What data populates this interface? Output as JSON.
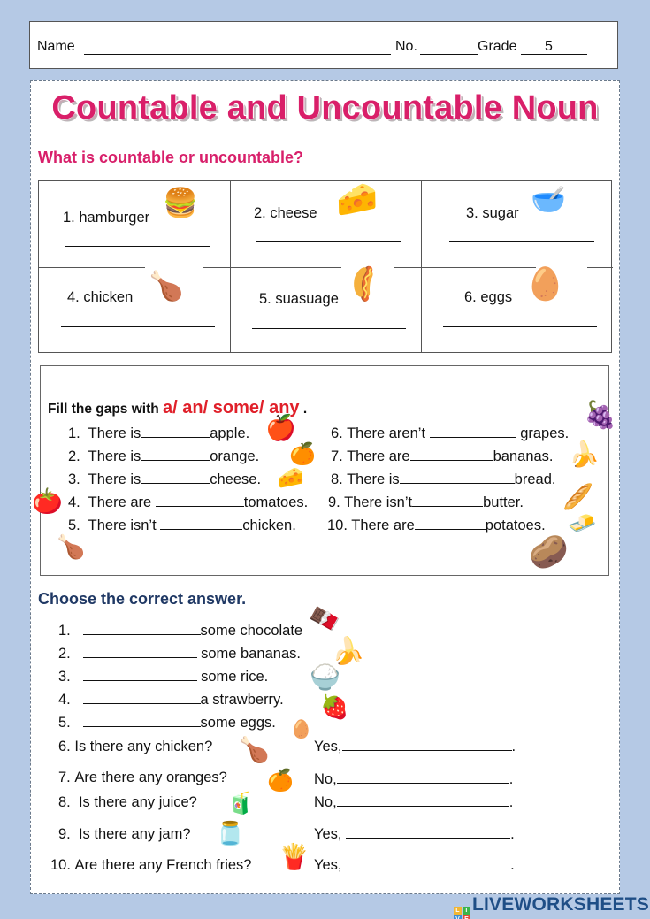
{
  "header": {
    "name_label": "Name",
    "no_label": "No.",
    "grade_label": "Grade",
    "grade_value": "5"
  },
  "title": "Countable and Uncountable Noun",
  "section1": {
    "heading": "What is countable or uncountable?",
    "items": [
      {
        "label": "1. hamburger",
        "icon": "hamburger-icon",
        "glyph": "🍔"
      },
      {
        "label": "2.  cheese",
        "icon": "cheese-icon",
        "glyph": "🧀"
      },
      {
        "label": "3. sugar",
        "icon": "sugar-bowl-icon",
        "glyph": "🥣"
      },
      {
        "label": "4. chicken",
        "icon": "roast-chicken-icon",
        "glyph": "🍗"
      },
      {
        "label": "5. suasuage",
        "icon": "sausage-icon",
        "glyph": "🌭"
      },
      {
        "label": "6. eggs",
        "icon": "eggs-icon",
        "glyph": "🥚"
      }
    ]
  },
  "section2": {
    "heading_prefix": "Fill the gaps with",
    "heading_options": "a/ an/ some/ any",
    "heading_suffix": ".",
    "items": [
      {
        "num": "1.",
        "before": "There is",
        "after": "apple."
      },
      {
        "num": "2.",
        "before": "There is",
        "after": "orange."
      },
      {
        "num": "3.",
        "before": "There is",
        "after": "cheese."
      },
      {
        "num": "4.",
        "before": "There are ",
        "after": "tomatoes."
      },
      {
        "num": "5.",
        "before": "There isn’t ",
        "after": "chicken."
      },
      {
        "num": "6.",
        "before": "There aren’t ",
        "after": " grapes."
      },
      {
        "num": "7.",
        "before": "There are",
        "after": "bananas."
      },
      {
        "num": "8.",
        "before": "There is",
        "after": "bread."
      },
      {
        "num": "9.",
        "before": "There isn’t",
        "after": "butter."
      },
      {
        "num": "10.",
        "before": "There are",
        "after": "potatoes."
      }
    ],
    "icons": [
      {
        "name": "apple-icon",
        "glyph": "🍎"
      },
      {
        "name": "orange-icon",
        "glyph": "🍊"
      },
      {
        "name": "cheese-icon",
        "glyph": "🧀"
      },
      {
        "name": "tomatoes-icon",
        "glyph": "🍅"
      },
      {
        "name": "roast-chicken-icon",
        "glyph": "🍗"
      },
      {
        "name": "grapes-icon",
        "glyph": "🍇"
      },
      {
        "name": "bananas-icon",
        "glyph": "🍌"
      },
      {
        "name": "bread-icon",
        "glyph": "🥖"
      },
      {
        "name": "butter-icon",
        "glyph": "🧈"
      },
      {
        "name": "potatoes-icon",
        "glyph": "🥔"
      }
    ]
  },
  "section3": {
    "heading": "Choose the correct answer.",
    "items": [
      {
        "num": "1.",
        "text": "some chocolate"
      },
      {
        "num": "2.",
        "text": "some bananas."
      },
      {
        "num": "3.",
        "text": "some rice."
      },
      {
        "num": "4.",
        "text": "a strawberry."
      },
      {
        "num": "5.",
        "text": "some eggs."
      }
    ],
    "questions": [
      {
        "num": "6.",
        "question": "Is there any chicken?",
        "answer_prefix": "Yes,"
      },
      {
        "num": "7.",
        "question": "Are there any oranges?",
        "answer_prefix": "No,"
      },
      {
        "num": "8.",
        "question": " Is there any juice?",
        "answer_prefix": "No,"
      },
      {
        "num": "9.",
        "question": " Is there any jam?",
        "answer_prefix": "Yes, "
      },
      {
        "num": "10.",
        "question": "Are there any French fries?",
        "answer_prefix": "Yes, "
      }
    ],
    "icons": [
      {
        "name": "chocolate-icon",
        "glyph": "🍫"
      },
      {
        "name": "bananas-icon",
        "glyph": "🍌"
      },
      {
        "name": "rice-bowl-icon",
        "glyph": "🍚"
      },
      {
        "name": "strawberry-icon",
        "glyph": "🍓"
      },
      {
        "name": "eggs-icon",
        "glyph": "🥚"
      },
      {
        "name": "roast-chicken-icon",
        "glyph": "🍗"
      },
      {
        "name": "orange-icon",
        "glyph": "🍊"
      },
      {
        "name": "juice-icon",
        "glyph": "🧃"
      },
      {
        "name": "jam-jar-icon",
        "glyph": "🫙"
      },
      {
        "name": "french-fries-icon",
        "glyph": "🍟"
      }
    ]
  },
  "footer": {
    "logo_text": "LIVEWORKSHEETS",
    "badge_letters": [
      "L",
      "I",
      "V",
      "E"
    ],
    "badge_colors": [
      "#f2b632",
      "#3bb54a",
      "#3c8fd6",
      "#e5493a"
    ]
  }
}
